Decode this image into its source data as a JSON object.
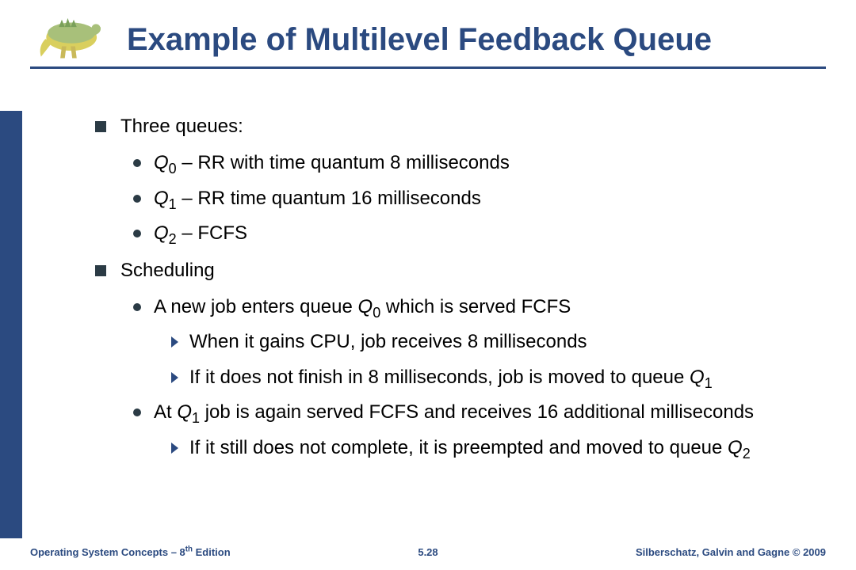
{
  "title": "Example of Multilevel Feedback Queue",
  "bullets": {
    "three_queues": "Three queues:",
    "q0": "Q_0 – RR with time quantum 8 milliseconds",
    "q1": "Q_1 – RR time quantum 16 milliseconds",
    "q2": "Q_2 – FCFS",
    "scheduling": "Scheduling",
    "new_job": "A new job enters queue Q_0 which is served FCFS",
    "gains_cpu": "When it gains CPU, job receives 8 milliseconds",
    "not_finish_8": "If it does not finish in 8 milliseconds, job is moved to queue Q_1",
    "at_q1": "At Q_1 job is again served FCFS and receives 16 additional milliseconds",
    "still_not": "If it still does not complete, it is preempted and moved to queue Q_2"
  },
  "footer": {
    "left": "Operating System Concepts – 8^th Edition",
    "center": "5.28",
    "right": "Silberschatz, Galvin and Gagne © 2009"
  }
}
